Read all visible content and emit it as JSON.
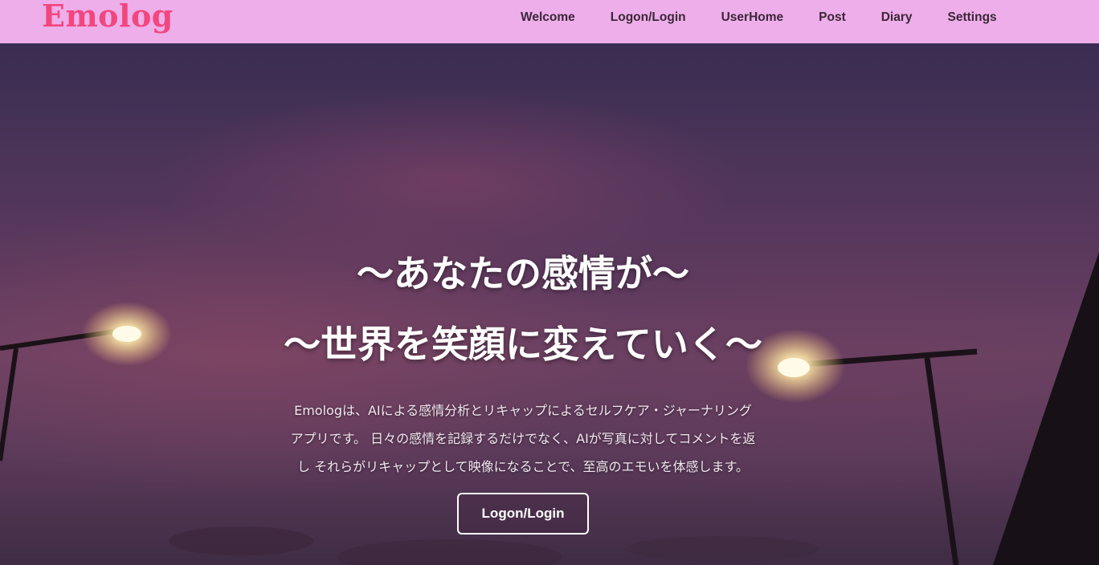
{
  "navbar": {
    "brand": "Emolog",
    "links": [
      "Welcome",
      "Logon/Login",
      "UserHome",
      "Post",
      "Diary",
      "Settings"
    ]
  },
  "hero": {
    "headline_1": "〜あなたの感情が〜",
    "headline_2": "〜世界を笑顔に変えていく〜",
    "description_lines": [
      "Emologは、AIによる感情分析とリキャップによるセルフケア・ジャーナリング",
      "アプリです。 日々の感情を記録するだけでなく、AIが写真に対してコメントを返",
      "し それらがリキャップとして映像になることで、至高のエモいを体感します。"
    ],
    "cta_label": "Logon/Login"
  },
  "colors": {
    "navbar_bg": "#eeaeea",
    "brand": "#f2467f",
    "nav_text": "#3a2838"
  }
}
